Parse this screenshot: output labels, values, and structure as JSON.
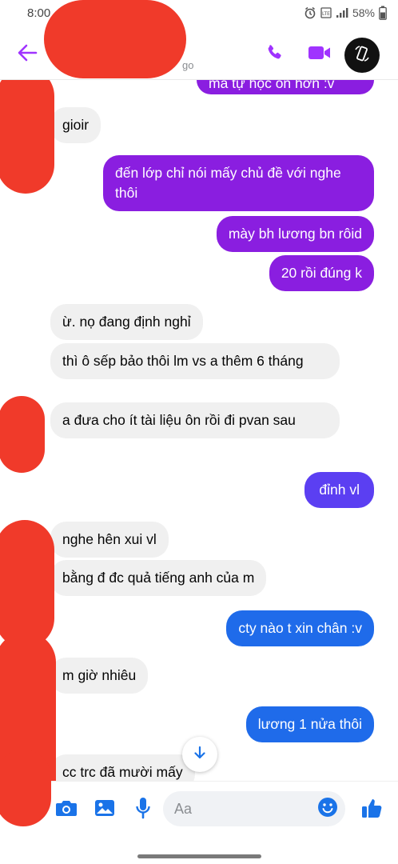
{
  "status_bar": {
    "time": "8:00",
    "battery": "58%",
    "icons": [
      "alarm-icon",
      "volte-icon",
      "signal-icon"
    ]
  },
  "header": {
    "contact_name": "",
    "contact_status": "go",
    "icons": [
      "back-arrow-icon",
      "phone-icon",
      "video-camera-icon",
      "rotate-screen-icon"
    ],
    "accent_color": "#a033ff"
  },
  "messages": [
    {
      "direction": "outgoing",
      "text": "mà tự học ôn hơn :v",
      "color": "#8a1ee0"
    },
    {
      "direction": "incoming",
      "text": "gioir"
    },
    {
      "direction": "outgoing",
      "text": "đến lớp chỉ nói mấy chủ đề với nghe thôi",
      "color": "#8a1ee0"
    },
    {
      "direction": "outgoing",
      "text": "mày bh lương bn rôid",
      "color": "#8a1ee0"
    },
    {
      "direction": "outgoing",
      "text": "20 rồi đúng k",
      "color": "#8a1ee0"
    },
    {
      "direction": "incoming",
      "text": "ừ. nọ đang định nghỉ"
    },
    {
      "direction": "incoming",
      "text": "thì ô sếp bảo thôi lm vs a thêm 6 tháng"
    },
    {
      "direction": "incoming",
      "text": "a đưa cho ít tài liệu ôn rồi đi pvan sau"
    },
    {
      "direction": "outgoing",
      "text": "đỉnh vl",
      "color": "#5b3ff2"
    },
    {
      "direction": "incoming",
      "text": "nghe hên xui vl"
    },
    {
      "direction": "incoming",
      "text": "bằng đ đc quả tiếng anh của m"
    },
    {
      "direction": "outgoing",
      "text": "cty nào t xin chân :v",
      "color": "#1f6bea"
    },
    {
      "direction": "incoming",
      "text": "m giờ nhiêu"
    },
    {
      "direction": "outgoing",
      "text": "lương 1 nửa thôi",
      "color": "#1f6bea"
    },
    {
      "direction": "incoming",
      "text": "cc trc đã mười mấy"
    }
  ],
  "composer": {
    "placeholder": "Aa",
    "icons": [
      "camera-icon",
      "gallery-icon",
      "microphone-icon",
      "emoji-icon",
      "thumbs-up-icon"
    ],
    "accent_color": "#1a73e8"
  },
  "scroll_down": {
    "icon": "arrow-down-icon"
  }
}
